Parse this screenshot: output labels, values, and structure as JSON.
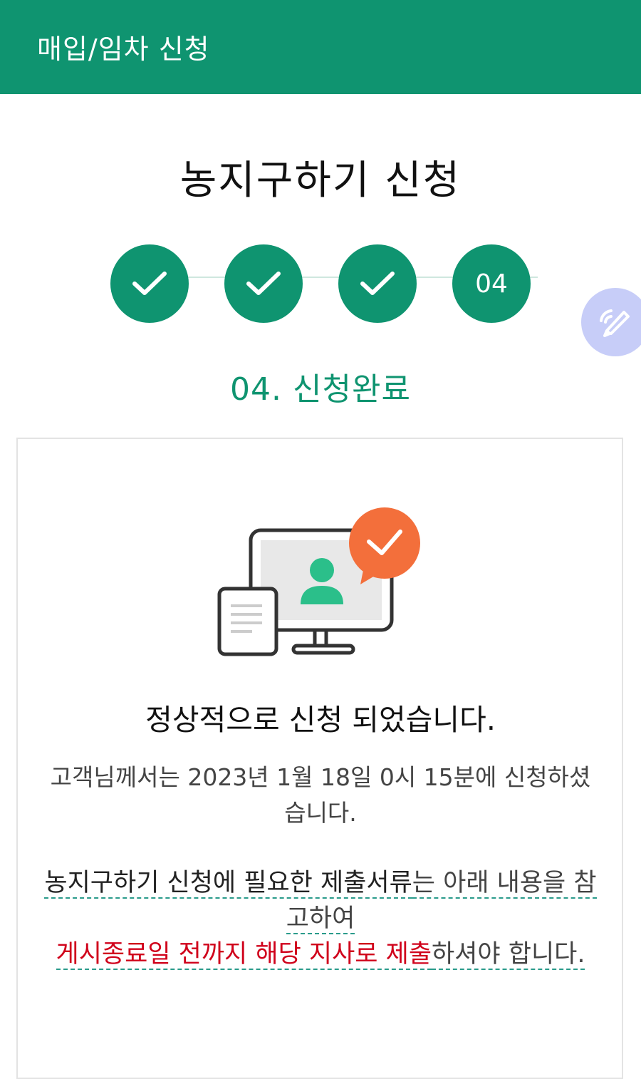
{
  "header": {
    "title": "매입/임차 신청"
  },
  "page": {
    "title": "농지구하기 신청"
  },
  "steps": {
    "items": [
      {
        "state": "done",
        "icon": "check-icon"
      },
      {
        "state": "done",
        "icon": "check-icon"
      },
      {
        "state": "done",
        "icon": "check-icon"
      },
      {
        "state": "current",
        "label": "04"
      }
    ],
    "current_label": "04. 신청완료"
  },
  "fab": {
    "icon": "pencil-wifi-icon"
  },
  "result": {
    "illustration": "monitor-user-check-illustration",
    "title": "정상적으로 신청 되었습니다.",
    "subtitle": "고객님께서는 2023년 1월 18일 0시 15분에 신청하셨습니다.",
    "notice_part1": "농지구하기 신청에 필요한 제출서류",
    "notice_part2": "는 아래 내용을 참고하여",
    "notice_part3": "게시종료일 전까지 해당 지사로 제출",
    "notice_part4": "하셔야 합니다."
  },
  "colors": {
    "brand": "#0f9470",
    "accent_orange": "#f36f3b",
    "alert_red": "#d0021b",
    "fab_bg": "#c7cdf8"
  }
}
